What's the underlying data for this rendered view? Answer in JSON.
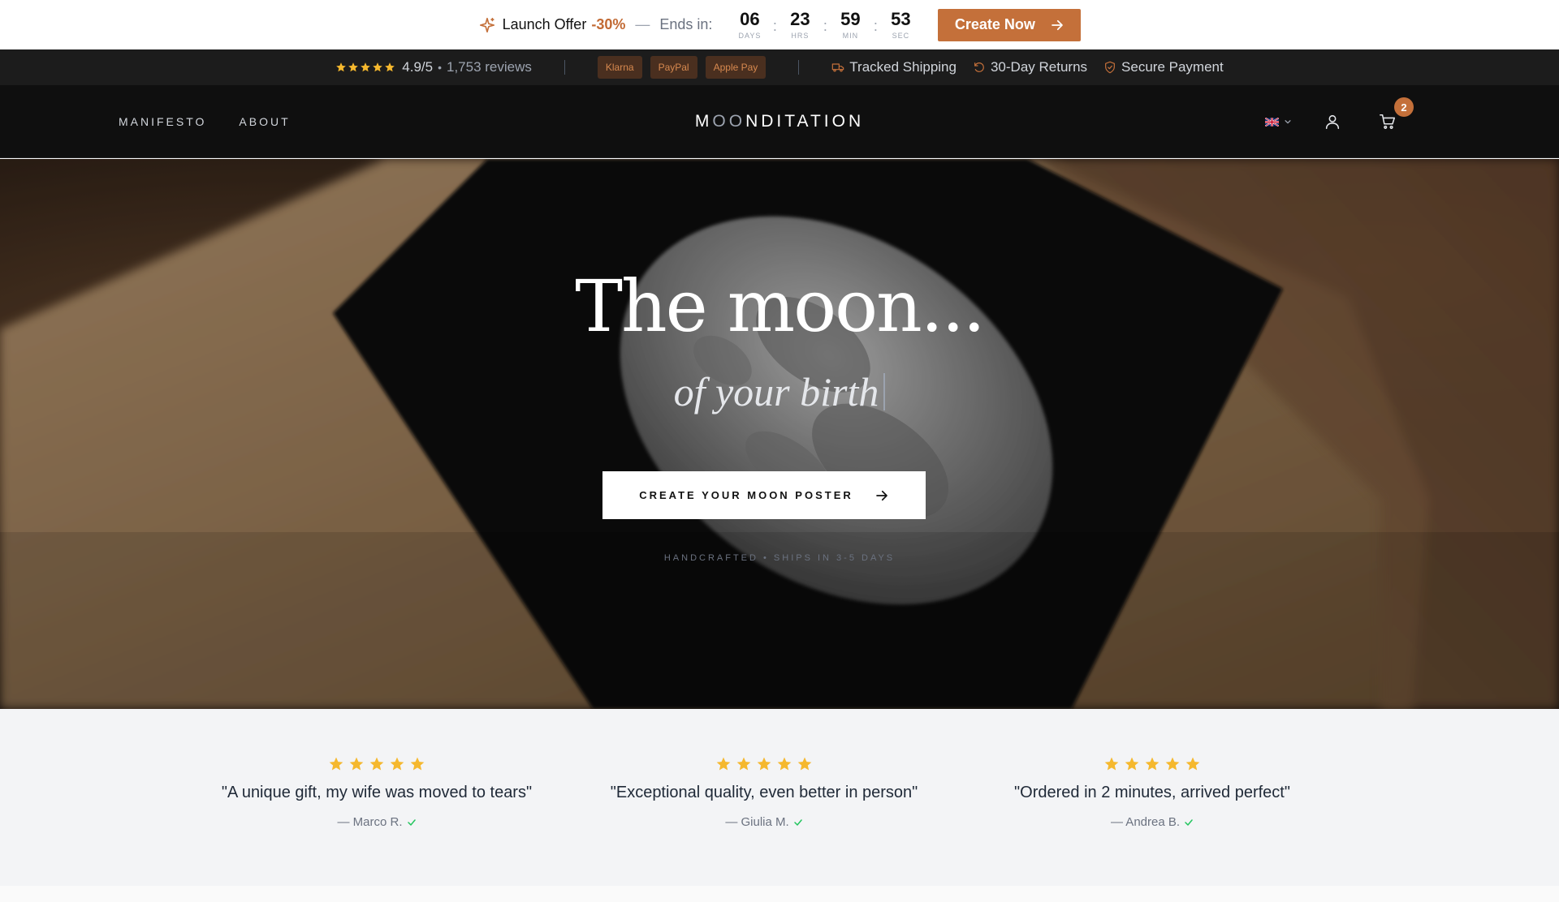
{
  "promo": {
    "label": "Launch Offer",
    "discount": "-30%",
    "dash": "—",
    "ends_in": "Ends in:",
    "countdown": [
      {
        "value": "06",
        "unit": "DAYS"
      },
      {
        "value": "23",
        "unit": "HRS"
      },
      {
        "value": "59",
        "unit": "MIN"
      },
      {
        "value": "53",
        "unit": "SEC"
      }
    ],
    "separator": ":",
    "cta_label": "Create Now",
    "icon": "sparkle-icon"
  },
  "trust": {
    "rating": "4.9/5",
    "dot": "•",
    "reviews": "1,753 reviews",
    "payments": [
      "Klarna",
      "PayPal",
      "Apple Pay"
    ],
    "perks": [
      "Tracked Shipping",
      "30-Day Returns",
      "Secure Payment"
    ]
  },
  "header": {
    "nav": [
      "MANIFESTO",
      "ABOUT"
    ],
    "logo_pre": "M",
    "logo_oo": "OO",
    "logo_post": "NDITATION",
    "cart_count": "2"
  },
  "hero": {
    "title": "The moon...",
    "subtitle": "of your birth",
    "cta_label": "CREATE YOUR MOON POSTER",
    "note": "HANDCRAFTED • SHIPS IN 3-5 DAYS"
  },
  "testimonials": [
    {
      "quote": "\"A unique gift, my wife was moved to tears\"",
      "author": "— Marco R.",
      "stars": 5
    },
    {
      "quote": "\"Exceptional quality, even better in person\"",
      "author": "— Giulia M.",
      "stars": 5
    },
    {
      "quote": "\"Ordered in 2 minutes, arrived perfect\"",
      "author": "— Andrea B.",
      "stars": 5
    }
  ],
  "colors": {
    "accent": "#c4703a",
    "star": "#f5b82e",
    "verified": "#22c55e",
    "dark_bg": "#0f0f0f"
  }
}
